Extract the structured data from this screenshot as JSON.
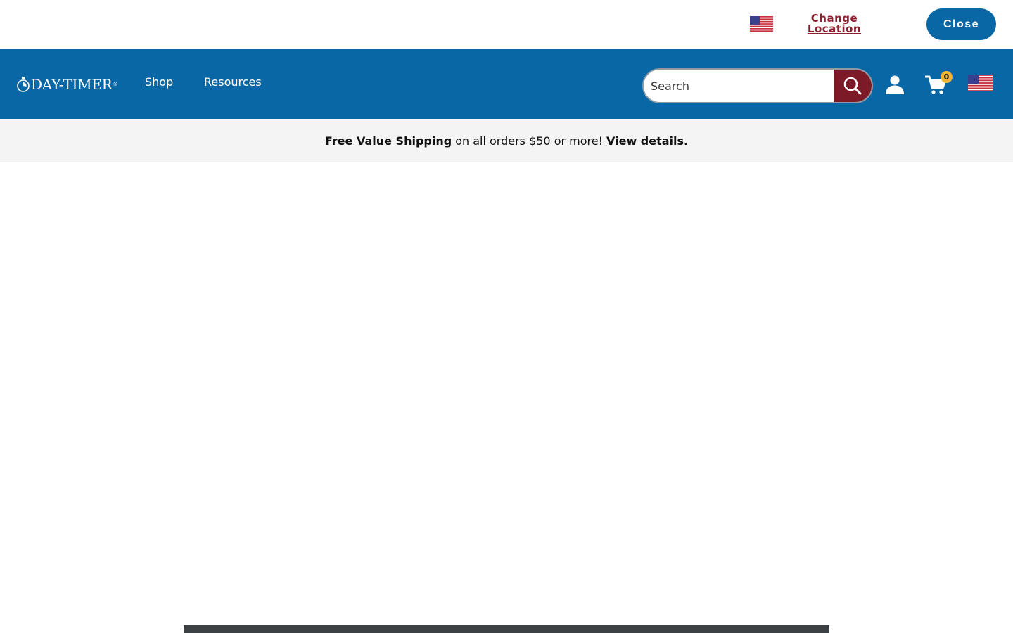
{
  "location_bar": {
    "flag_icon": "us-flag-icon",
    "change_label": "Change Location",
    "close_label": "Close"
  },
  "header": {
    "logo_text": "DAY-TIMER",
    "logo_reg": "®",
    "nav": {
      "shop": "Shop",
      "resources": "Resources"
    },
    "search": {
      "placeholder": "Search",
      "value": ""
    },
    "cart_count": "0"
  },
  "promo": {
    "bold": "Free Value Shipping",
    "text": "on all orders $50 or more!",
    "link": "View details."
  },
  "colors": {
    "brand_blue": "#0a67a6",
    "search_button": "#7d1a28",
    "change_location": "#8a1f2e",
    "cart_badge": "#f2b233"
  }
}
